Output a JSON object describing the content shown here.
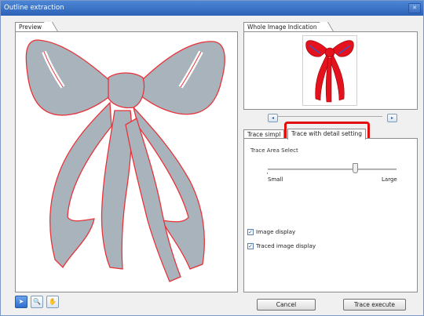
{
  "window": {
    "title": "Outline extraction",
    "close_glyph": "✕"
  },
  "preview": {
    "tab_label": "Preview"
  },
  "whole_image": {
    "tab_label": "Whole Image Indication"
  },
  "tabs": [
    {
      "label": "Trace simpl"
    },
    {
      "label": "Trace with detail setting"
    }
  ],
  "trace_area": {
    "label": "Trace Area Select",
    "min_label": "Small",
    "max_label": "Large",
    "level": 0.68
  },
  "checkboxes": [
    {
      "label": "Image display",
      "checked": true
    },
    {
      "label": "Traced image display",
      "checked": true
    }
  ],
  "buttons": {
    "cancel": "Cancel",
    "trace_execute": "Trace execute"
  },
  "tools": [
    {
      "icon": "pointer-icon",
      "glyph": "➤",
      "active": true
    },
    {
      "icon": "zoom-icon",
      "glyph": "🔍",
      "active": false
    },
    {
      "icon": "hand-icon",
      "glyph": "✋",
      "active": false
    }
  ],
  "nav_glyphs": {
    "left": "◂",
    "right": "▸"
  },
  "colors": {
    "outline_red": "#e8333a",
    "ribbon_fill": "#a9b3bb",
    "bow_red": "#e3121c",
    "highlight": "#e01010"
  }
}
